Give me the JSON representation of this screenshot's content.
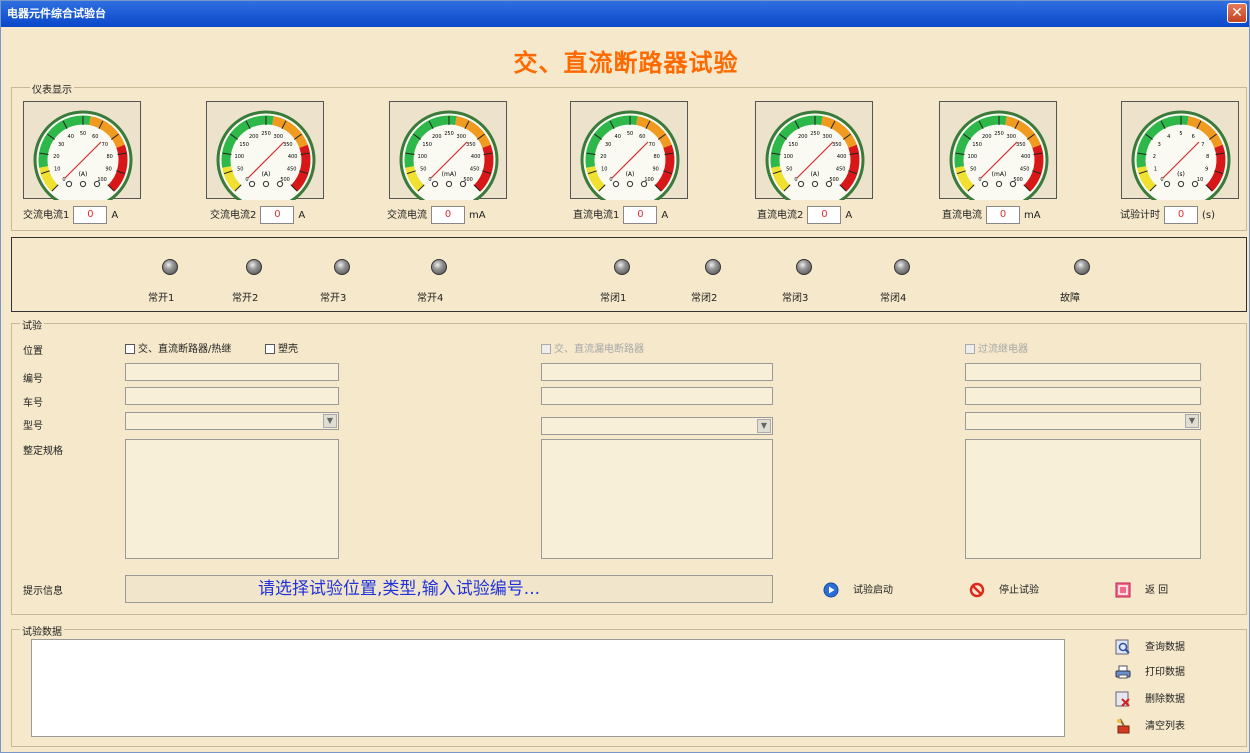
{
  "window": {
    "title": "电器元件综合试验台",
    "close": "✕"
  },
  "page_title": "交、直流断路器试验",
  "meters": {
    "legend": "仪表显示",
    "items": [
      {
        "label": "交流电流1",
        "value": "0",
        "unit": "A",
        "unit_mark": "(A)",
        "ticks": [
          "0",
          "10",
          "20",
          "30",
          "40",
          "50",
          "60",
          "70",
          "80",
          "90",
          "100"
        ]
      },
      {
        "label": "交流电流2",
        "value": "0",
        "unit": "A",
        "unit_mark": "(A)",
        "ticks": [
          "0",
          "50",
          "100",
          "150",
          "200",
          "250",
          "300",
          "350",
          "400",
          "450",
          "500"
        ]
      },
      {
        "label": "交流电流",
        "value": "0",
        "unit": "mA",
        "unit_mark": "(mA)",
        "ticks": [
          "0",
          "50",
          "100",
          "150",
          "200",
          "250",
          "300",
          "350",
          "400",
          "450",
          "500"
        ]
      },
      {
        "label": "直流电流1",
        "value": "0",
        "unit": "A",
        "unit_mark": "(A)",
        "ticks": [
          "0",
          "10",
          "20",
          "30",
          "40",
          "50",
          "60",
          "70",
          "80",
          "90",
          "100"
        ]
      },
      {
        "label": "直流电流2",
        "value": "0",
        "unit": "A",
        "unit_mark": "(A)",
        "ticks": [
          "0",
          "50",
          "100",
          "150",
          "200",
          "250",
          "300",
          "350",
          "400",
          "450",
          "500"
        ]
      },
      {
        "label": "直流电流",
        "value": "0",
        "unit": "mA",
        "unit_mark": "(mA)",
        "ticks": [
          "0",
          "50",
          "100",
          "150",
          "200",
          "250",
          "300",
          "350",
          "400",
          "450",
          "500"
        ]
      },
      {
        "label": "试验计时",
        "value": "0",
        "unit": "(s)",
        "unit_mark": "(s)",
        "ticks": [
          "0",
          "1",
          "2",
          "3",
          "4",
          "5",
          "6",
          "7",
          "8",
          "9",
          "10"
        ]
      }
    ]
  },
  "lamps": [
    {
      "label": "常开1"
    },
    {
      "label": "常开2"
    },
    {
      "label": "常开3"
    },
    {
      "label": "常开4"
    },
    {
      "label": "常闭1"
    },
    {
      "label": "常闭2"
    },
    {
      "label": "常闭3"
    },
    {
      "label": "常闭4"
    },
    {
      "label": "故障"
    }
  ],
  "test": {
    "legend": "试验",
    "labels": {
      "position": "位置",
      "number": "编号",
      "car": "车号",
      "model": "型号",
      "spec": "整定规格"
    },
    "checks": {
      "acdc_breaker": "交、直流断路器/热继",
      "plastic_case": "塑壳",
      "leakage_breaker": "交、直流漏电断路器",
      "overvoltage_relay": "过流继电器"
    },
    "hint_label": "提示信息",
    "hint_text": "请选择试验位置,类型,输入试验编号...",
    "buttons": {
      "start": "试验启动",
      "stop": "停止试验",
      "back": "返 回"
    }
  },
  "data": {
    "legend": "试验数据",
    "buttons": {
      "query": "查询数据",
      "print": "打印数据",
      "delete": "删除数据",
      "clear": "清空列表"
    }
  },
  "colors": {
    "accent_title": "#ff6a00",
    "hint_text": "#2032d8",
    "value_red": "#e03030",
    "titlebar": "#0a47c9"
  }
}
